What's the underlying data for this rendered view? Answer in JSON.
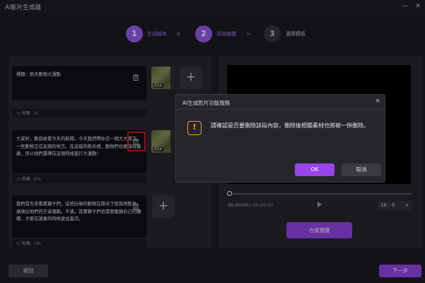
{
  "window": {
    "title": "AI影片生成器",
    "minimize_icon": "minimize-icon",
    "close_icon": "close-icon"
  },
  "steps": [
    {
      "number": "1",
      "label": "生成腳本",
      "state": "active"
    },
    {
      "number": "2",
      "label": "添加媒體",
      "state": "active"
    },
    {
      "number": "3",
      "label": "選擇模板",
      "state": "inactive"
    }
  ],
  "scenes": [
    {
      "text": "標題：熱天動物大運動",
      "duration": "推薦: 2s",
      "thumb_duration": "21s"
    },
    {
      "text": "大家好，歡迎收看今天的新聞。今天我們帶你去一個大大陽下，一些動物正在走路的地方。在這樣的熱天裡，動物們也要保持健康，所以他們選擇在這個時候進行大運動！",
      "duration": "推薦: 20s",
      "thumb_duration": "21s"
    },
    {
      "text": "我們首先來看看獅子們，這些壯碩的動物在陽光下悠哉地散步，展現出他們的王者風範。不過，其實獅子們也需要鍛鍊自己的體魄，才能在運會的時候更加靈活。",
      "duration": "推薦: 19s"
    }
  ],
  "add_label": "+",
  "player": {
    "current_time": "00:00:00",
    "separator": "/",
    "total_time": "00:00:00",
    "ratio": "16 : 9",
    "compose_label": "合成預覽"
  },
  "footer": {
    "back_label": "返回",
    "next_label": "下一步"
  },
  "dialog": {
    "title": "AI生成影片功能服務",
    "close": "×",
    "message": "請確認是否要刪除該段內容，刪除後相關素材也將被一併刪除。",
    "ok_label": "OK",
    "cancel_label": "取消",
    "icon": "warning-icon"
  },
  "colors": {
    "accent": "#9646e8",
    "warning": "#f0a31e",
    "highlight": "#e0121e"
  }
}
